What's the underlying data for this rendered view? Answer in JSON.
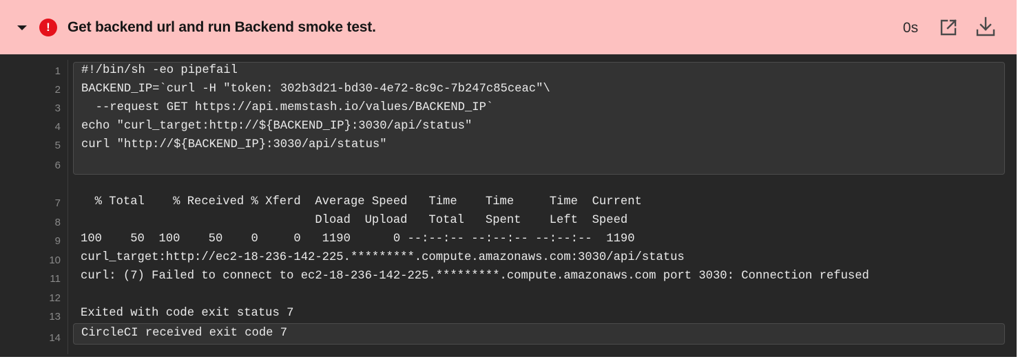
{
  "step": {
    "title": "Get backend url and run Backend smoke test.",
    "duration": "0s",
    "status_glyph": "!",
    "status": "failed",
    "colors": {
      "header_bg": "#fdc1c0",
      "status_red": "#e5111b",
      "log_bg": "#272727",
      "log_text": "#eaeaea",
      "line_number": "#8a8a8a"
    },
    "icons": {
      "collapse": "chevron-down-icon",
      "status": "error-icon",
      "open_external": "open-external-icon",
      "download": "download-icon"
    }
  },
  "log": {
    "line_numbers": [
      "1",
      "2",
      "3",
      "4",
      "5",
      "6",
      "7",
      "8",
      "9",
      "10",
      "11",
      "12",
      "13",
      "14"
    ],
    "command_lines": [
      "#!/bin/sh -eo pipefail",
      "BACKEND_IP=`curl -H \"token: 302b3d21-bd30-4e72-8c9c-7b247c85ceac\"\\",
      "  --request GET https://api.memstash.io/values/BACKEND_IP`",
      "echo \"curl_target:http://${BACKEND_IP}:3030/api/status\"",
      "curl \"http://${BACKEND_IP}:3030/api/status\"",
      ""
    ],
    "output_lines": [
      "  % Total    % Received % Xferd  Average Speed   Time    Time     Time  Current",
      "                                 Dload  Upload   Total   Spent    Left  Speed",
      "100    50  100    50    0     0   1190      0 --:--:-- --:--:-- --:--:--  1190",
      "curl_target:http://ec2-18-236-142-225.*********.compute.amazonaws.com:3030/api/status",
      "curl: (7) Failed to connect to ec2-18-236-142-225.*********.compute.amazonaws.com port 3030: Connection refused",
      "",
      "Exited with code exit status 7"
    ],
    "exit_line": "CircleCI received exit code 7"
  }
}
